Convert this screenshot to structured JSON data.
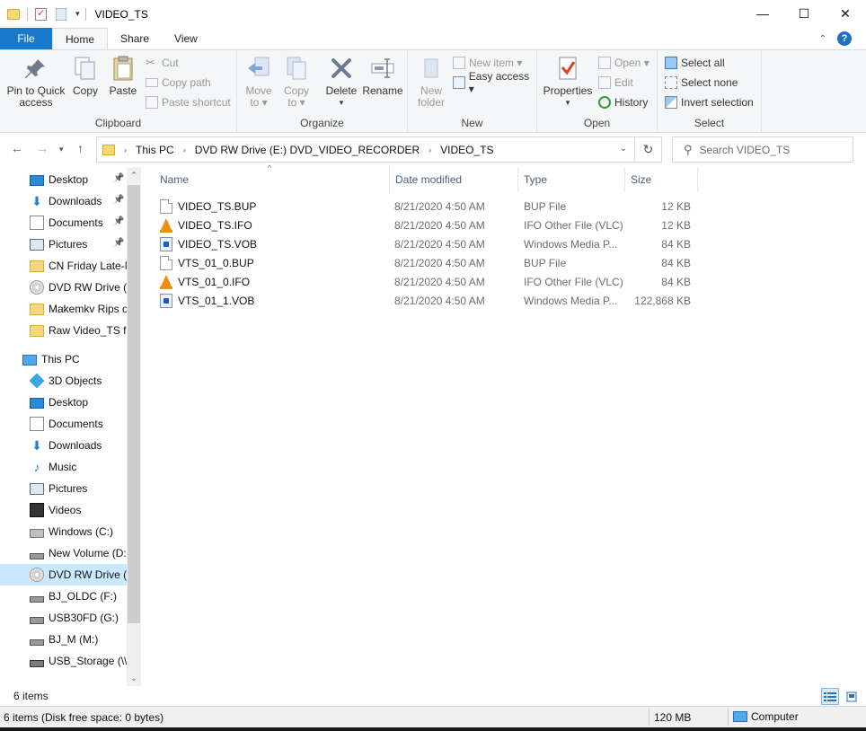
{
  "window": {
    "title": "VIDEO_TS",
    "controls": {
      "minimize": "—",
      "maximize": "☐",
      "close": "✕"
    }
  },
  "tabs": {
    "file": "File",
    "home": "Home",
    "share": "Share",
    "view": "View"
  },
  "ribbon": {
    "clipboard": {
      "label": "Clipboard",
      "pin": [
        "Pin to Quick",
        "access"
      ],
      "copy": "Copy",
      "paste": "Paste",
      "cut": "Cut",
      "copy_path": "Copy path",
      "paste_shortcut": "Paste shortcut"
    },
    "organize": {
      "label": "Organize",
      "move_to": [
        "Move",
        "to ▾"
      ],
      "copy_to": [
        "Copy",
        "to ▾"
      ],
      "delete": [
        "Delete",
        "▾"
      ],
      "rename": "Rename"
    },
    "new": {
      "label": "New",
      "new_folder": [
        "New",
        "folder"
      ],
      "new_item": "New item ▾",
      "easy_access": "Easy access ▾"
    },
    "open": {
      "label": "Open",
      "properties": [
        "Properties",
        "▾"
      ],
      "open": "Open ▾",
      "edit": "Edit",
      "history": "History"
    },
    "select": {
      "label": "Select",
      "select_all": "Select all",
      "select_none": "Select none",
      "invert_selection": "Invert selection"
    }
  },
  "address": {
    "crumbs": [
      "This PC",
      "DVD RW Drive (E:) DVD_VIDEO_RECORDER",
      "VIDEO_TS"
    ],
    "search_placeholder": "Search VIDEO_TS"
  },
  "nav": {
    "quick_access": [
      {
        "label": "Desktop",
        "icon": "desktop-icon",
        "pinned": true
      },
      {
        "label": "Downloads",
        "icon": "downloads-icon",
        "pinned": true
      },
      {
        "label": "Documents",
        "icon": "documents-icon",
        "pinned": true
      },
      {
        "label": "Pictures",
        "icon": "pictures-icon",
        "pinned": true
      },
      {
        "label": "CN Friday Late-N",
        "icon": "folder-icon",
        "pinned": false
      },
      {
        "label": "DVD RW Drive (E",
        "icon": "dvd-icon",
        "pinned": false
      },
      {
        "label": "Makemkv Rips o",
        "icon": "folder-icon",
        "pinned": false
      },
      {
        "label": "Raw Video_TS fo",
        "icon": "folder-icon",
        "pinned": false
      }
    ],
    "this_pc": "This PC",
    "this_pc_items": [
      {
        "label": "3D Objects",
        "icon": "3d-objects-icon"
      },
      {
        "label": "Desktop",
        "icon": "desktop-icon"
      },
      {
        "label": "Documents",
        "icon": "documents-icon"
      },
      {
        "label": "Downloads",
        "icon": "downloads-icon"
      },
      {
        "label": "Music",
        "icon": "music-icon"
      },
      {
        "label": "Pictures",
        "icon": "pictures-icon"
      },
      {
        "label": "Videos",
        "icon": "videos-icon"
      },
      {
        "label": "Windows (C:)",
        "icon": "windows-drive-icon"
      },
      {
        "label": "New Volume (D:",
        "icon": "drive-icon"
      },
      {
        "label": "DVD RW Drive (E",
        "icon": "dvd-icon",
        "selected": true
      },
      {
        "label": "BJ_OLDC (F:)",
        "icon": "drive-icon"
      },
      {
        "label": "USB30FD (G:)",
        "icon": "usb-drive-icon"
      },
      {
        "label": "BJ_M (M:)",
        "icon": "drive-icon"
      },
      {
        "label": "USB_Storage (\\\\",
        "icon": "network-drive-icon"
      }
    ]
  },
  "columns": {
    "name": "Name",
    "date": "Date modified",
    "type": "Type",
    "size": "Size"
  },
  "files": [
    {
      "name": "VIDEO_TS.BUP",
      "date": "8/21/2020 4:50 AM",
      "type": "BUP File",
      "size": "12 KB",
      "icon": "doc"
    },
    {
      "name": "VIDEO_TS.IFO",
      "date": "8/21/2020 4:50 AM",
      "type": "IFO Other File (VLC)",
      "size": "12 KB",
      "icon": "vlc"
    },
    {
      "name": "VIDEO_TS.VOB",
      "date": "8/21/2020 4:50 AM",
      "type": "Windows Media P...",
      "size": "84 KB",
      "icon": "wmp"
    },
    {
      "name": "VTS_01_0.BUP",
      "date": "8/21/2020 4:50 AM",
      "type": "BUP File",
      "size": "84 KB",
      "icon": "doc"
    },
    {
      "name": "VTS_01_0.IFO",
      "date": "8/21/2020 4:50 AM",
      "type": "IFO Other File (VLC)",
      "size": "84 KB",
      "icon": "vlc"
    },
    {
      "name": "VTS_01_1.VOB",
      "date": "8/21/2020 4:50 AM",
      "type": "Windows Media P...",
      "size": "122,868 KB",
      "icon": "wmp"
    }
  ],
  "status": {
    "item_count": "6 items",
    "details": "6 items (Disk free space: 0 bytes)",
    "size": "120 MB",
    "location": "Computer"
  },
  "colors": {
    "accent": "#1979ca",
    "selected": "#cce8ff",
    "header_text": "#4c607a"
  }
}
